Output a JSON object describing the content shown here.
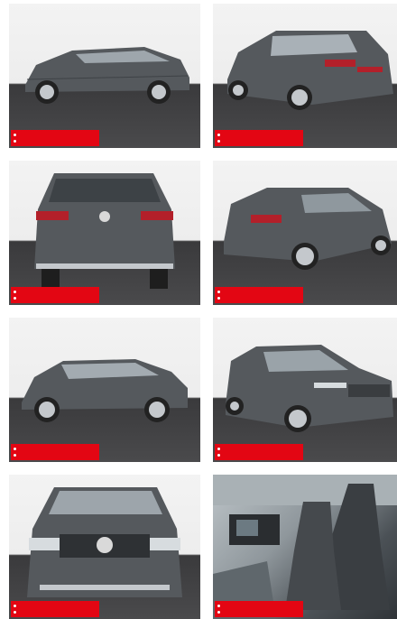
{
  "gallery": {
    "title": "",
    "photos": [
      {
        "view": "side-left",
        "badge_text": ""
      },
      {
        "view": "rear-three-quarter-right",
        "badge_text": ""
      },
      {
        "view": "rear",
        "badge_text": ""
      },
      {
        "view": "rear-three-quarter-left",
        "badge_text": ""
      },
      {
        "view": "side-left-2",
        "badge_text": ""
      },
      {
        "view": "front-three-quarter-left",
        "badge_text": ""
      },
      {
        "view": "front",
        "badge_text": ""
      },
      {
        "view": "interior-front-seats",
        "badge_text": ""
      }
    ]
  },
  "colors": {
    "badge": "#e30613",
    "car_body": "#55595d",
    "floor": "#3d3d40",
    "backdrop": "#efefef"
  }
}
